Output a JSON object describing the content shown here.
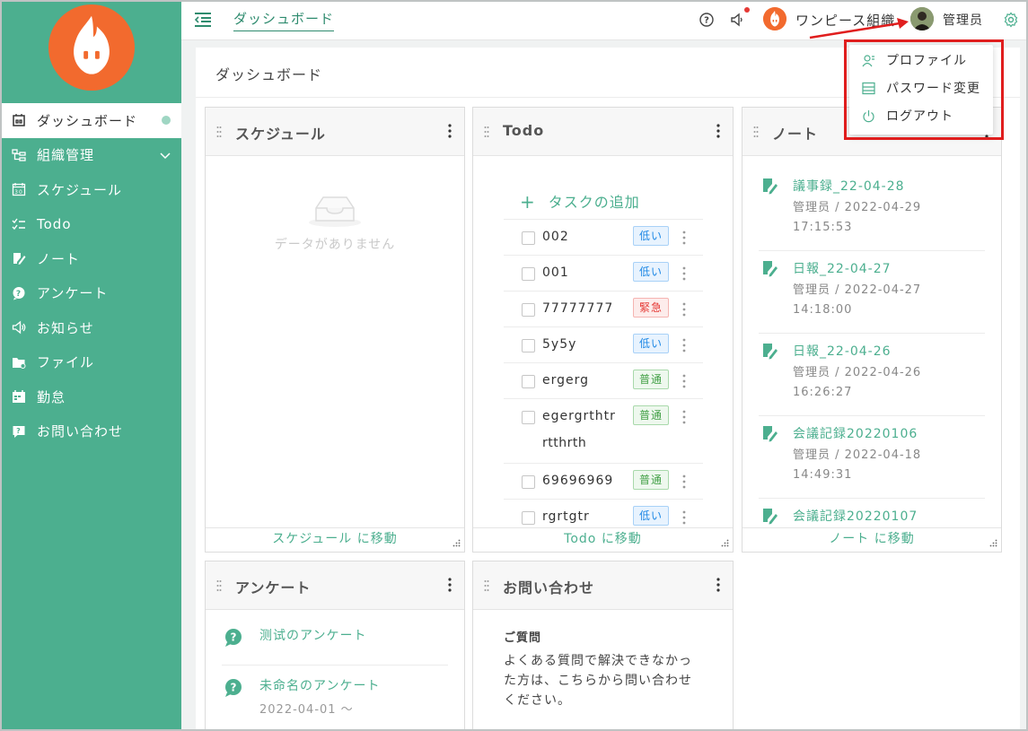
{
  "sidebar": {
    "items": [
      {
        "label": "ダッシュボード",
        "icon": "dashboard-icon",
        "active": true
      },
      {
        "label": "組織管理",
        "icon": "org-chart-icon",
        "expandable": true
      },
      {
        "label": "スケジュール",
        "icon": "calendar-icon"
      },
      {
        "label": "Todo",
        "icon": "checklist-icon"
      },
      {
        "label": "ノート",
        "icon": "note-edit-icon"
      },
      {
        "label": "アンケート",
        "icon": "survey-icon"
      },
      {
        "label": "お知らせ",
        "icon": "megaphone-icon"
      },
      {
        "label": "ファイル",
        "icon": "folder-icon"
      },
      {
        "label": "勤怠",
        "icon": "attendance-icon"
      },
      {
        "label": "お問い合わせ",
        "icon": "inquiry-icon"
      }
    ]
  },
  "header": {
    "breadcrumb": "ダッシュボード",
    "org_name": "ワンピース組織",
    "user_name": "管理员"
  },
  "main": {
    "page_title": "ダッシュボード"
  },
  "schedule_card": {
    "title": "スケジュール",
    "empty_text": "データがありません",
    "footer": "スケジュール に移動"
  },
  "todo_card": {
    "title": "Todo",
    "add_label": "タスクの追加",
    "footer": "Todo に移動",
    "items": [
      {
        "text": "002",
        "priority": "低い"
      },
      {
        "text": "001",
        "priority": "低い"
      },
      {
        "text": "77777777",
        "priority": "緊急"
      },
      {
        "text": "5y5y",
        "priority": "低い"
      },
      {
        "text": "ergerg",
        "priority": "普通"
      },
      {
        "text": "egergrthtr",
        "text2": "rtthrth",
        "priority": "普通"
      },
      {
        "text": "69696969",
        "priority": "普通"
      },
      {
        "text": "rgrtgtr",
        "priority": "低い"
      }
    ]
  },
  "note_card": {
    "title": "ノート",
    "footer": "ノート に移動",
    "items": [
      {
        "title": "議事録_22-04-28",
        "meta": "管理员 / 2022-04-29 17:15:53"
      },
      {
        "title": "日報_22-04-27",
        "meta": "管理员 / 2022-04-27 14:18:00"
      },
      {
        "title": "日報_22-04-26",
        "meta": "管理员 / 2022-04-26 16:26:27"
      },
      {
        "title": "会議記録20220106",
        "meta": "管理员 / 2022-04-18 14:49:31"
      },
      {
        "title": "会議記録20220107",
        "meta": ""
      }
    ]
  },
  "survey_card": {
    "title": "アンケート",
    "items": [
      {
        "title": "测试のアンケート",
        "date": ""
      },
      {
        "title": "未命名のアンケート",
        "date": "2022-04-01 〜"
      }
    ]
  },
  "contact_card": {
    "title": "お問い合わせ",
    "question_label": "ご質問",
    "body": "よくある質問で解決できなかった方は、こちらから問い合わせください。"
  },
  "user_menu": {
    "items": [
      {
        "label": "プロファイル",
        "icon": "profile-icon"
      },
      {
        "label": "パスワード変更",
        "icon": "password-icon"
      },
      {
        "label": "ログアウト",
        "icon": "power-icon"
      }
    ]
  },
  "colors": {
    "brand": "#4caf8f",
    "accent": "#f26a2e",
    "annotation": "#e01e1e"
  }
}
